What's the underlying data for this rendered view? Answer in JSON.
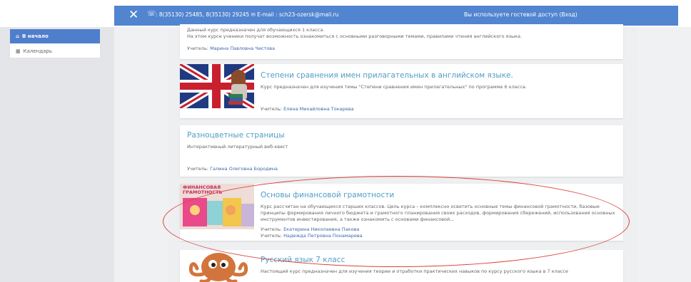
{
  "header": {
    "close_symbol": "✕",
    "phone_symbol": "☏",
    "contacts": ": 8(35130) 25485, 8(35130) 29245 ✉ E-mail : sch23-ozersk@mail.ru",
    "guest_access": "Вы используете гостевой доступ (Вход)"
  },
  "sidebar": {
    "items": [
      {
        "label": "В начало",
        "icon": "home-icon",
        "icon_glyph": "⌂"
      },
      {
        "label": "Календарь",
        "icon": "calendar-icon",
        "icon_glyph": "▦"
      }
    ]
  },
  "courses": [
    {
      "title": "",
      "description": "Данный курс предназначен для обучающихся 1 класса.\nНа этом курсе ученики получат возможность ознакомиться с основными разговорными темами, правилами чтения английского языка.",
      "teacher_label": "Учитель:",
      "teachers": [
        "Марина Павловна Чистова"
      ]
    },
    {
      "title": "Степени сравнения имен прилагательных в английском языке.",
      "description": "Курс предназначен для изучения темы \"Степени сравнения имен прилагательных\" по программе 6 класса.",
      "teacher_label": "Учитель:",
      "teachers": [
        "Елена Михайловна Токарева"
      ]
    },
    {
      "title": "Разноцветные страницы",
      "description": "Интерактивный литературный веб-квест",
      "teacher_label": "Учитель:",
      "teachers": [
        "Галина Олеговна Бородина"
      ]
    },
    {
      "title": "Основы финансовой грамотности",
      "description": "Курс рассчитан на обучающихся старших классов. Цель курса – комплексно осветить основные темы финансовой грамотности, базовые принципы формирования личного бюджета и грамотного планирования своих расходов, формирования сбережений, использования основных инструментов инвестирования, а также ознакомить с основами финансовой…",
      "teacher_label": "Учитель:",
      "teachers": [
        "Екатерина Николаевна Пакова",
        "Надежда Петровна Понамарева"
      ],
      "image_text": "ФИНАНСОВАЯ ГРАМОТНОСТЬ"
    },
    {
      "title": "Русский язык 7 класс",
      "description": "Настоящий курс предназначен для изучения теории и отработки практических навыков по курсу русского языка в 7 классе",
      "teacher_label": "",
      "teachers": []
    }
  ],
  "colors": {
    "navbar": "#5285d0",
    "title_link": "#4f9ec4",
    "teacher_link": "#3d66a8",
    "highlight_oval": "#d9423a"
  }
}
